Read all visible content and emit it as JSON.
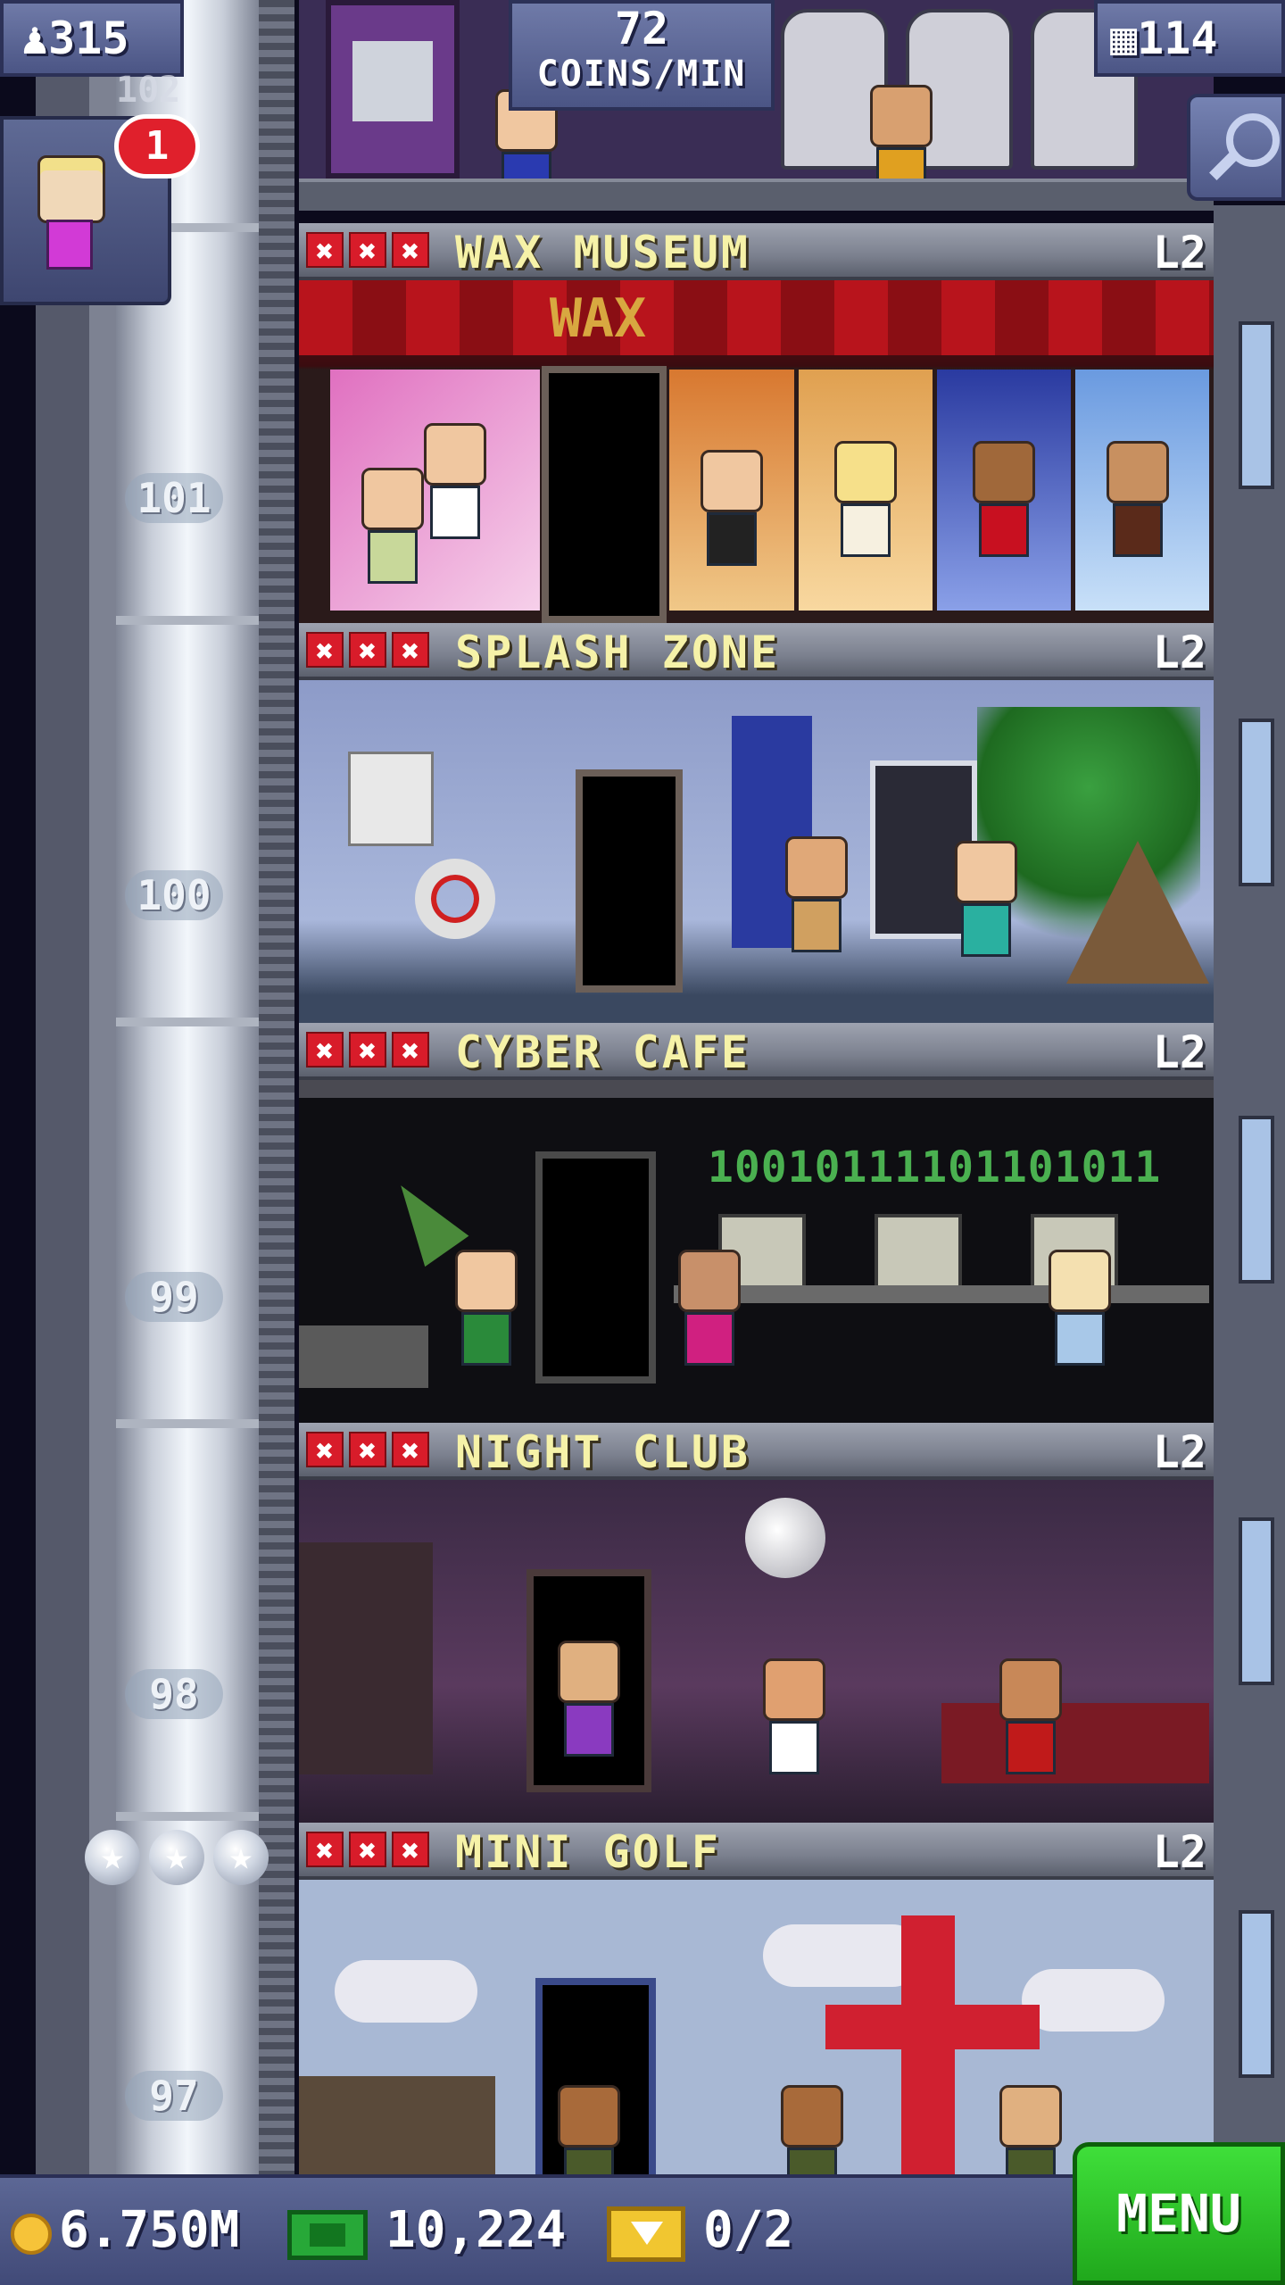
{
  "hud": {
    "population": "315",
    "coins_per_min_value": "72",
    "coins_per_min_unit": "COINS/MIN",
    "floor_count": "114",
    "notification_count": "1",
    "partial_floor_number": "102"
  },
  "shaft": {
    "floor_numbers": [
      "101",
      "100",
      "99",
      "98",
      "97"
    ]
  },
  "floors": [
    {
      "name": "WAX MUSEUM",
      "level": "L2",
      "sign": "WAX",
      "stock_marks": [
        "✖",
        "✖",
        "✖"
      ]
    },
    {
      "name": "SPLASH ZONE",
      "level": "L2",
      "stock_marks": [
        "✖",
        "✖",
        "✖"
      ]
    },
    {
      "name": "CYBER CAFE",
      "level": "L2",
      "screen_text": "10010111101101011",
      "stock_marks": [
        "✖",
        "✖",
        "✖"
      ]
    },
    {
      "name": "NIGHT CLUB",
      "level": "L2",
      "stock_marks": [
        "✖",
        "✖",
        "✖"
      ]
    },
    {
      "name": "MINI GOLF",
      "level": "L2",
      "stock_marks": [
        "✖",
        "✖",
        "✖"
      ]
    }
  ],
  "bottom_bar": {
    "coins": "6.750M",
    "tower_bux": "10,224",
    "tickets": "0/2",
    "menu_label": "MENU"
  },
  "icons": {
    "population": "person-icon",
    "floors": "building-icon",
    "search": "magnifier-icon",
    "coins": "coin-icon",
    "bux": "bux-icon",
    "tickets": "ticket-icon",
    "stars": "star-icon"
  },
  "colors": {
    "floor_title": "#f6f2a8",
    "stock_mark": "#d81c2a",
    "hud_panel": "#5b6695",
    "menu_button": "#2fc22a"
  }
}
